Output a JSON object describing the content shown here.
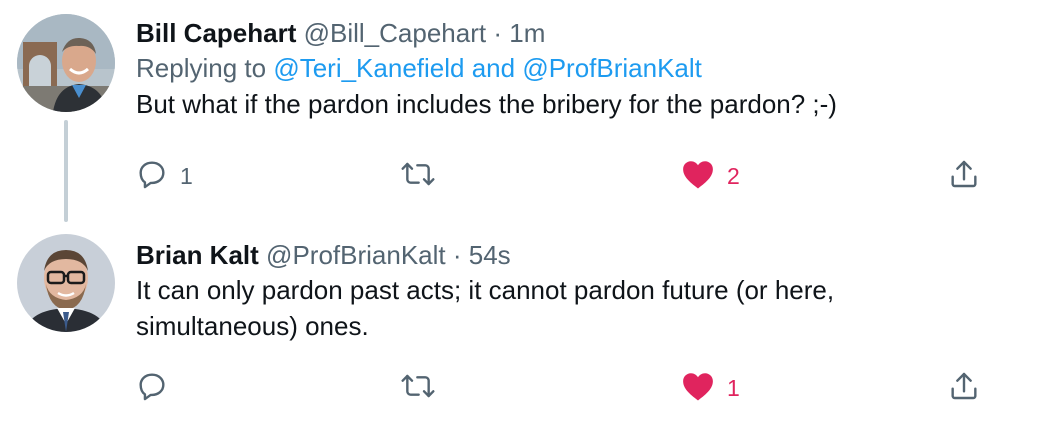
{
  "tweets": [
    {
      "display_name": "Bill Capehart",
      "handle": "@Bill_Capehart",
      "separator": "·",
      "time": "1m",
      "replying_prefix": "Replying to ",
      "mentions": [
        "@Teri_Kanefield",
        "@ProfBrianKalt"
      ],
      "conjunction": " and ",
      "body_lines": [
        "But what if the pardon includes the bribery for the pardon?  ;-)"
      ],
      "reply_count": "1",
      "retweet_count": "",
      "like_count": "2",
      "liked": true
    },
    {
      "display_name": "Brian Kalt",
      "handle": "@ProfBrianKalt",
      "separator": "·",
      "time": "54s",
      "body_lines": [
        "It can only pardon past acts; it cannot pardon future (or here,",
        "simultaneous) ones."
      ],
      "reply_count": "",
      "retweet_count": "",
      "like_count": "1",
      "liked": true
    }
  ],
  "icons": {
    "reply": "speech-bubble-icon",
    "retweet": "retweet-arrows-icon",
    "like": "heart-icon",
    "share": "share-upload-icon"
  },
  "colors": {
    "text": "#0f1419",
    "secondary": "#536471",
    "link": "#1d9bf0",
    "like": "#e0245e",
    "thread_line": "#c4cfd6"
  }
}
